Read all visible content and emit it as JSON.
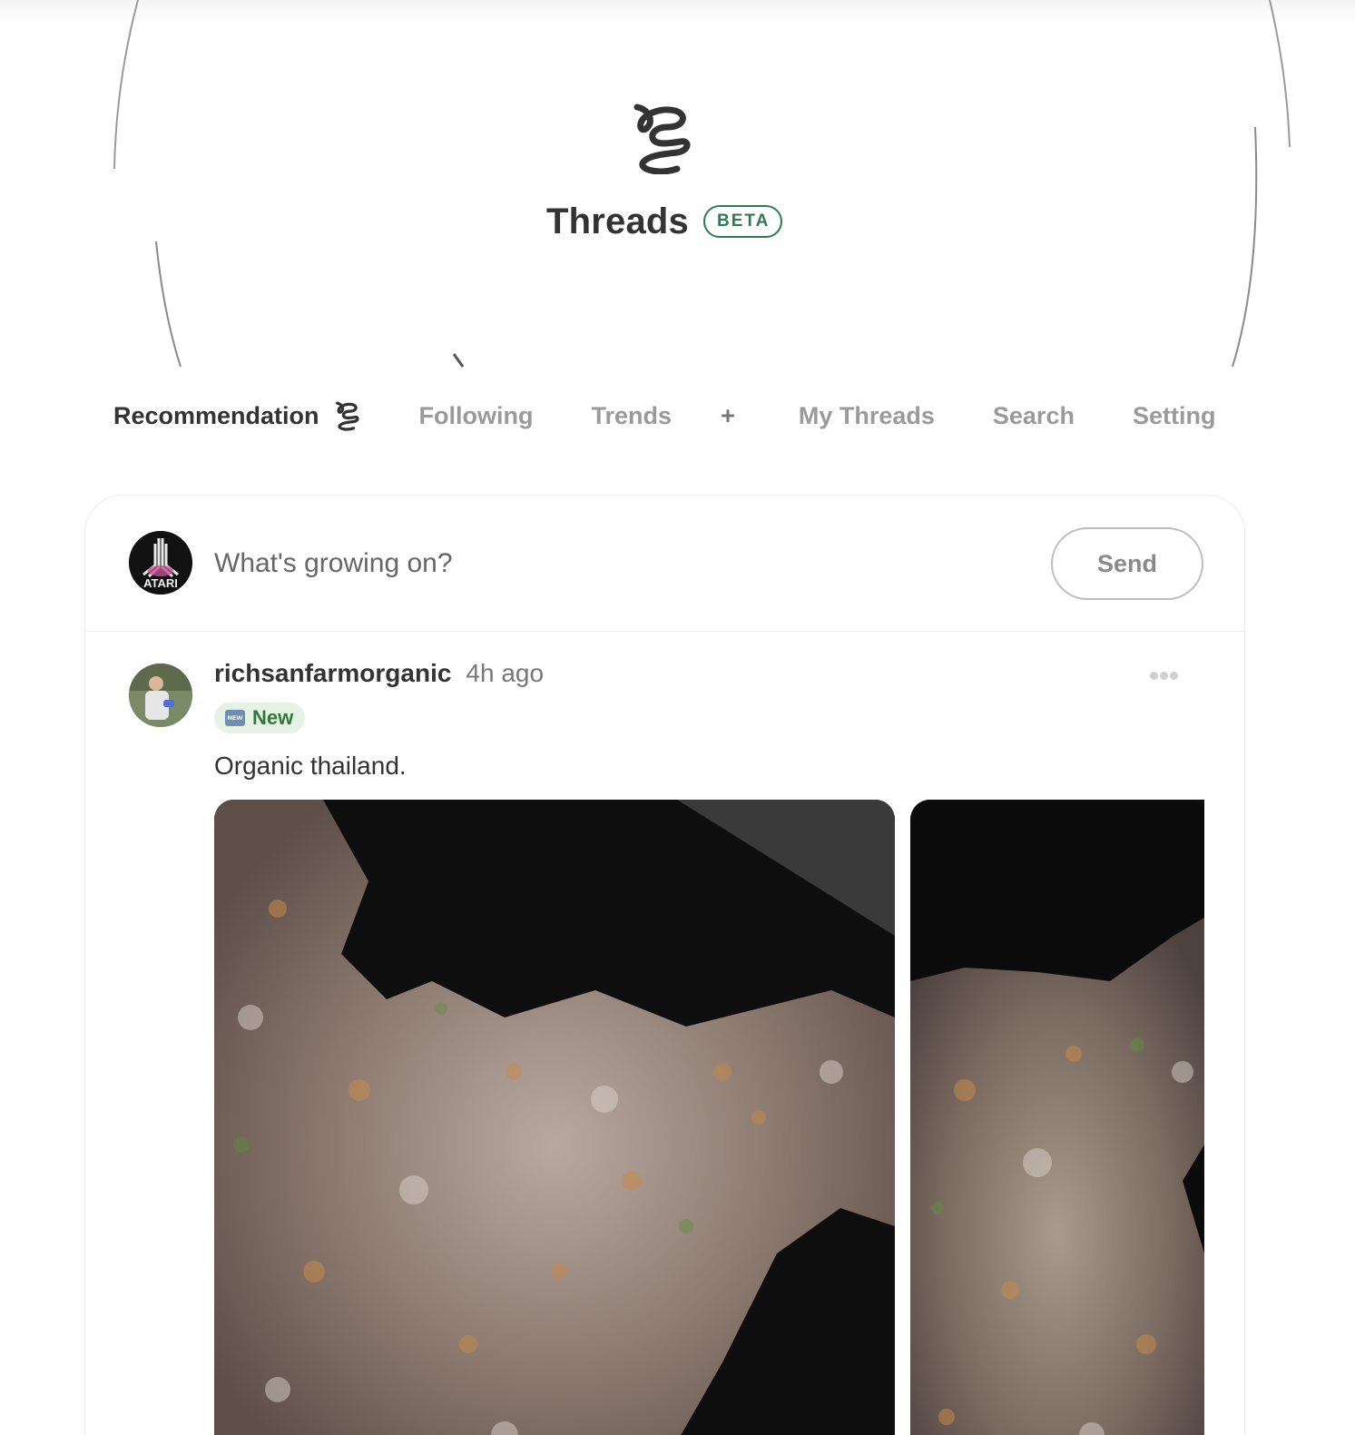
{
  "app": {
    "title": "Threads",
    "badge": "BETA"
  },
  "nav": {
    "tabs": [
      {
        "label": "Recommendation",
        "active": true,
        "icon": "threads-logo-icon"
      },
      {
        "label": "Following",
        "active": false
      },
      {
        "label": "Trends",
        "active": false
      },
      {
        "label": "+",
        "active": false
      },
      {
        "label": "My Threads",
        "active": false
      },
      {
        "label": "Search",
        "active": false
      },
      {
        "label": "Setting",
        "active": false
      }
    ]
  },
  "composer": {
    "placeholder": "What's growing on?",
    "send_label": "Send",
    "avatar_text": "ATARI"
  },
  "post": {
    "username": "richsanfarmorganic",
    "time": "4h ago",
    "badge_icon": "NEW",
    "badge": "New",
    "text": "Organic thailand.",
    "image_count": 2
  },
  "colors": {
    "accent_green": "#2e7d4f",
    "badge_bg": "#e6f2e3",
    "text_dark": "#333333",
    "text_muted": "#9a9a9a"
  }
}
